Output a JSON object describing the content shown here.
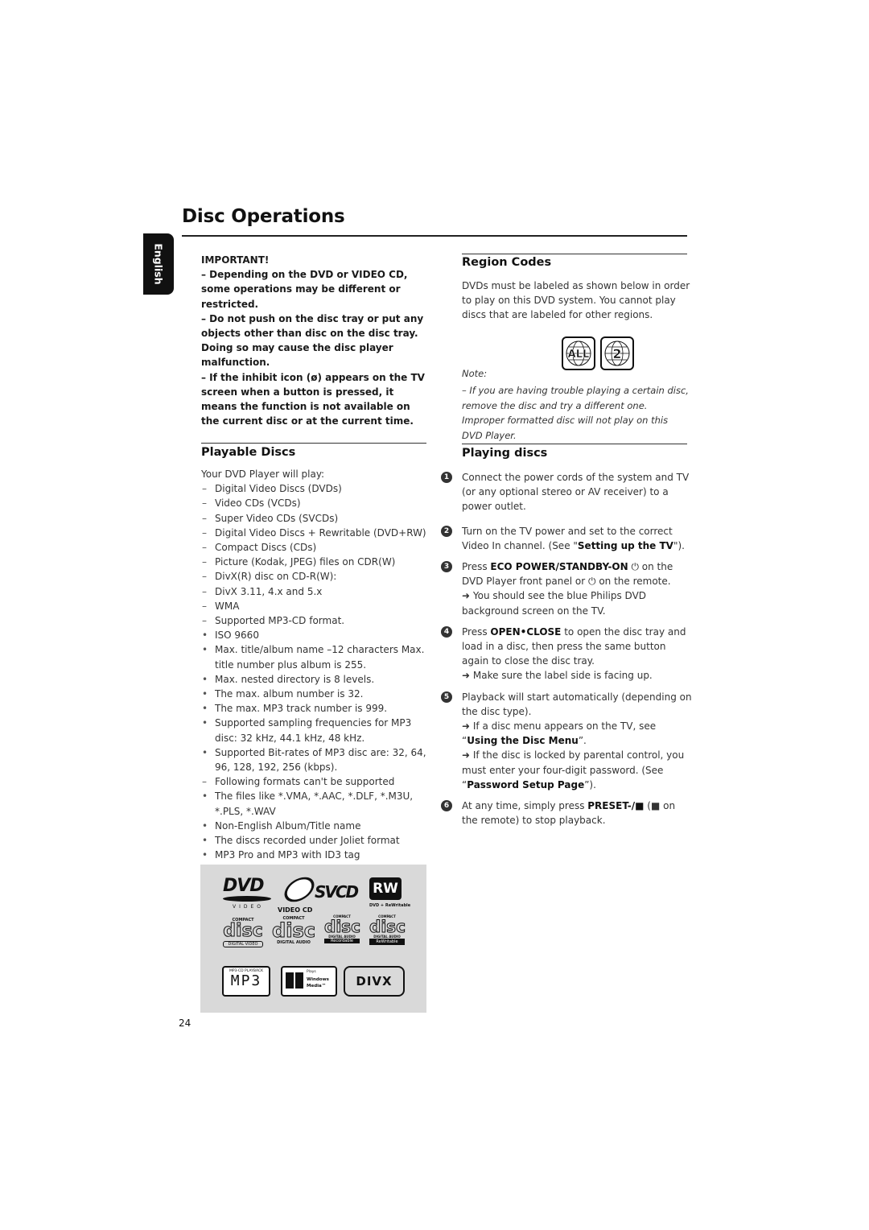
{
  "page": {
    "title": "Disc Operations",
    "language_tab": "English",
    "page_number": "24"
  },
  "important": {
    "heading": "IMPORTANT!",
    "items": [
      "–  Depending on the DVD or VIDEO CD, some operations may be different or restricted.",
      "–  Do not push on the disc tray or put any objects other than disc on the disc tray. Doing so may cause the disc player malfunction.",
      "–  If the inhibit icon (ø) appears on the TV screen when a button is pressed, it means the function is not available on the current disc or at the current time."
    ]
  },
  "playable_discs": {
    "heading": "Playable Discs",
    "intro": "Your DVD Player will play:",
    "items": [
      {
        "marker": "–",
        "text": "Digital Video Discs (DVDs)"
      },
      {
        "marker": "–",
        "text": "Video CDs (VCDs)"
      },
      {
        "marker": "–",
        "text": "Super Video CDs (SVCDs)"
      },
      {
        "marker": "–",
        "text": "Digital Video Discs + Rewritable (DVD+RW)"
      },
      {
        "marker": "–",
        "text": "Compact Discs (CDs)"
      },
      {
        "marker": "–",
        "text": "Picture (Kodak, JPEG) files on CDR(W)"
      },
      {
        "marker": "–",
        "text": "DivX(R) disc on CD-R(W):"
      },
      {
        "marker": "–",
        "text": "DivX 3.11, 4.x and 5.x"
      },
      {
        "marker": "–",
        "text": "WMA"
      },
      {
        "marker": "–",
        "text": "Supported MP3-CD format."
      },
      {
        "marker": "•",
        "text": "ISO 9660"
      },
      {
        "marker": "•",
        "text": "Max. title/album name –12 characters Max. title number plus album is 255."
      },
      {
        "marker": "•",
        "text": "Max. nested directory is 8 levels."
      },
      {
        "marker": "•",
        "text": "The max. album number is 32."
      },
      {
        "marker": "•",
        "text": "The max. MP3 track number is 999."
      },
      {
        "marker": "•",
        "text": "Supported sampling frequencies for MP3 disc: 32 kHz, 44.1 kHz, 48 kHz."
      },
      {
        "marker": "•",
        "text": "Supported Bit-rates of MP3 disc are: 32, 64, 96, 128, 192, 256 (kbps)."
      },
      {
        "marker": "–",
        "text": "Following formats can't be supported"
      },
      {
        "marker": "•",
        "text": "The files like *.VMA, *.AAC, *.DLF, *.M3U, *.PLS, *.WAV"
      },
      {
        "marker": "•",
        "text": "Non-English Album/Title name"
      },
      {
        "marker": "•",
        "text": "The discs recorded under Joliet format"
      },
      {
        "marker": "•",
        "text": "MP3 Pro and MP3 with ID3 tag"
      }
    ],
    "logos": {
      "dvd": "DVD",
      "dvd_sub": "VIDEO",
      "vcd": "VIDEO CD",
      "svcd": "SVCD",
      "rw": "RW",
      "rw_sub": "DVD + ReWritable",
      "cd_compact": "COMPACT",
      "cd_disc": "disc",
      "cd_video": "DIGITAL VIDEO",
      "cd_audio": "DIGITAL AUDIO",
      "cd_recordable": "Recordable",
      "cd_rewritable": "ReWritable",
      "mp3_top": "MP3-CD PLAYBACK",
      "mp3": "MP3",
      "wm_plays": "Plays",
      "wm_windows": "Windows",
      "wm_media": "Media™",
      "divx": "DIVX"
    }
  },
  "region_codes": {
    "heading": "Region Codes",
    "text": "DVDs must be labeled as shown below in order to play on this DVD system. You cannot play discs that are labeled for other regions.",
    "icons": [
      "ALL",
      "2"
    ],
    "note_label": "Note:",
    "note_text": "–  If you are having trouble playing a certain disc, remove the disc and try a different one. Improper formatted disc will not play on this DVD Player."
  },
  "playing_discs": {
    "heading": "Playing discs",
    "steps": [
      {
        "num": "1",
        "pre": "Connect the power cords of the system and TV (or any optional stereo or AV receiver) to a power outlet.",
        "bold": "",
        "post": ""
      },
      {
        "num": "2",
        "pre": "Turn on the TV power and set to the correct Video In channel. (See \"",
        "bold": "Setting up the TV",
        "post": "\")."
      },
      {
        "num": "3",
        "pre": "Press ",
        "bold": "ECO POWER/STANDBY-ON",
        "post": " ⏻ on the DVD Player front panel or ⏻ on the remote.",
        "result": "➜ You should see the blue Philips DVD background screen on the TV."
      },
      {
        "num": "4",
        "pre": "Press ",
        "bold": "OPEN•CLOSE",
        "post": " to open the disc tray and load in a disc, then press the same button again to close the disc tray.",
        "result": "➜ Make sure the label side is facing up."
      },
      {
        "num": "5",
        "pre": "Playback will start automatically (depending on the disc type).",
        "bold": "",
        "post": "",
        "result_a_pre": "➜ If a disc menu appears on the TV, see “",
        "result_a_bold": "Using the Disc Menu",
        "result_a_post": "”.",
        "result_b_pre": "➜ If the disc is locked by parental control, you must enter your four-digit password. (See “",
        "result_b_bold": "Password Setup Page",
        "result_b_post": "”)."
      },
      {
        "num": "6",
        "pre": "At any time, simply press ",
        "bold": "PRESET-/■",
        "post": " (■ on the remote) to stop playback."
      }
    ]
  }
}
